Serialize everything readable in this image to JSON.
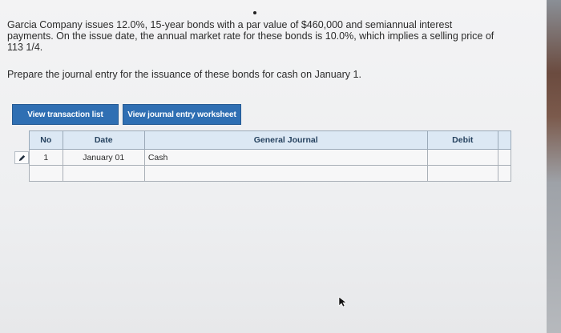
{
  "problem": {
    "text": "Garcia Company issues 12.0%, 15-year bonds with a par value of $460,000 and semiannual interest payments. On the issue date, the annual market rate for these bonds is 10.0%, which implies a selling price of 113 1/4."
  },
  "instruction": "Prepare the journal entry for the issuance of these bonds for cash on January 1.",
  "buttons": {
    "transaction_list": "View transaction list",
    "journal_worksheet": "View journal entry worksheet"
  },
  "journal": {
    "headers": [
      "No",
      "Date",
      "General Journal",
      "Debit",
      ""
    ],
    "rows": [
      {
        "no": "1",
        "date": "January 01",
        "account": "Cash",
        "debit": "",
        "extra": ""
      },
      {
        "no": "",
        "date": "",
        "account": "",
        "debit": "",
        "extra": ""
      }
    ]
  },
  "icons": {
    "edit": "pencil-icon",
    "cursor": "mouse-pointer-icon"
  },
  "colors": {
    "button_bg": "#2f6fb3",
    "header_bg": "#dce8f4"
  }
}
